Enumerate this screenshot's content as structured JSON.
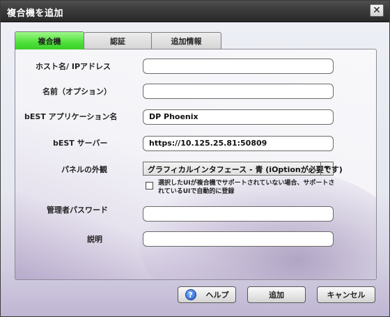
{
  "window": {
    "title": "複合機を追加",
    "close_label": "✕"
  },
  "tabs": [
    {
      "label": "複合機",
      "active": true
    },
    {
      "label": "認証",
      "active": false
    },
    {
      "label": "追加情報",
      "active": false
    }
  ],
  "form": {
    "host": {
      "label": "ホスト名/ IPアドレス",
      "value": ""
    },
    "name": {
      "label": "名前（オプション）",
      "value": ""
    },
    "app_name": {
      "label": "bEST アプリケーション名",
      "value": "DP Phoenix"
    },
    "server": {
      "label": "bEST サーバー",
      "value": "https://10.125.25.81:50809"
    },
    "panel": {
      "label": "パネルの外観",
      "selected": "グラフィカルインタフェース - 青 (iOptionが必要です)",
      "checkbox_label": "選択したUIが複合機でサポートされていない場合、サポートされているUIで自動的に登録",
      "checkbox_checked": false
    },
    "admin_password": {
      "label": "管理者パスワード",
      "value": ""
    },
    "description": {
      "label": "説明",
      "value": ""
    }
  },
  "buttons": {
    "help": "ヘルプ",
    "add": "追加",
    "cancel": "キャンセル"
  },
  "colors": {
    "active_tab": "#4fe03a",
    "titlebar": "#3a3a3a"
  },
  "icons": {
    "help": "help-icon",
    "close": "close-icon",
    "dropdown": "chevron-down-icon"
  }
}
